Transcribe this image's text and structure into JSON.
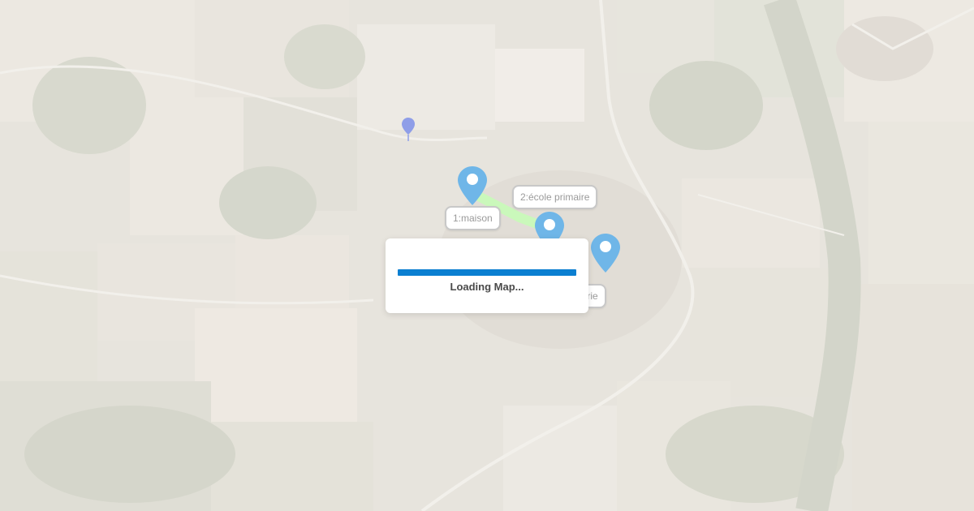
{
  "map": {
    "view": "satellite",
    "loading_text": "Loading Map...",
    "loading_progress": 1.0,
    "route_color": "#7dff5a",
    "marker_color": "#6fb6e8",
    "markers": [
      {
        "label": "1:maison"
      },
      {
        "label": "2:école primaire"
      },
      {
        "label": "3:boulangerie"
      }
    ]
  }
}
